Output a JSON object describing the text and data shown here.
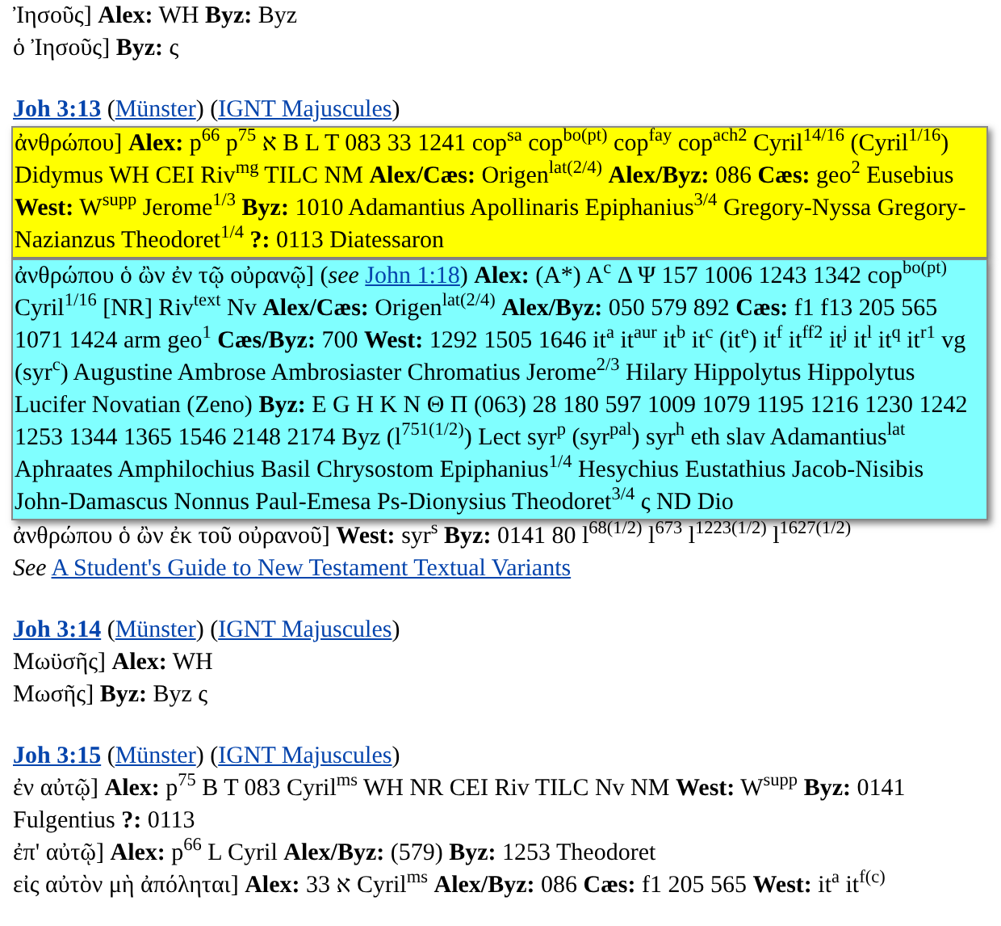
{
  "sections": [
    {
      "readings": [
        {
          "parts": [
            {
              "kind": "text",
              "text": "Ἰησοῦς] **Alex:** WH **Byz:** Byz"
            }
          ]
        },
        {
          "parts": [
            {
              "kind": "text",
              "text": "ὁ Ἰησοῦς] **Byz:** ς"
            }
          ]
        }
      ]
    },
    {
      "heading": {
        "verse": "Joh 3:13",
        "links": [
          {
            "open": "(",
            "text": "Münster",
            "close": ")"
          },
          {
            "open": "(",
            "text": "IGNT Majuscules",
            "close": ")"
          }
        ]
      },
      "readings": [
        {
          "color": "#ffff00",
          "parts": [
            {
              "kind": "text",
              "text": "ἀνθρώπου] **Alex:** p$^{66}$ p$^{75}$ א B L T 083 33 1241 cop$^{sa}$ cop$^{bo(pt)}$ cop$^{fay}$ cop$^{ach2}$ Cyril$^{14/16}$ (Cyril$^{1/16}$) Didymus WH CEI Riv$^{mg}$ TILC NM **Alex/Cæs:** Origen$^{lat(2/4)}$ **Alex/Byz:** 086 **Cæs:** geo$^{2}$ Eusebius **West:** W$^{supp}$ Jerome$^{1/3}$ **Byz:** 1010 Adamantius Apollinaris Epiphanius$^{3/4}$ Gregory-Nyssa Gregory-Nazianzus Theodoret$^{1/4}$ **?:** 0113 Diatessaron"
            }
          ]
        },
        {
          "color": "#80ffff",
          "parts": [
            {
              "kind": "text",
              "text": "ἀνθρώπου ὁ ὢν ἐν τῷ οὐρανῷ] (*see* "
            },
            {
              "kind": "link",
              "text": "John 1:18"
            },
            {
              "kind": "text",
              "text": ") **Alex:** (A*) A$^{c}$ Δ Ψ 157 1006 1243 1342 cop$^{bo(pt)}$ Cyril$^{1/16}$ [NR] Riv$^{text}$ Nv **Alex/Cæs:** Origen$^{lat(2/4)}$ **Alex/Byz:** 050 579 892 **Cæs:** f1 f13 205 565 1071 1424 arm geo$^{1}$ **Cæs/Byz:** 700 **West:** 1292 1505 1646 it$^{a}$ it$^{aur}$ it$^{b}$ it$^{c}$ (it$^{e}$) it$^{f}$ it$^{ff2}$ it$^{j}$ it$^{l}$ it$^{q}$ it$^{r1}$ vg (syr$^{c}$) Augustine Ambrose Ambrosiaster Chromatius Jerome$^{2/3}$ Hilary Hippolytus Hippolytus Lucifer Novatian (Zeno) **Byz:** E G H K N Θ Π (063) 28 180 597 1009 1079 1195 1216 1230 1242 1253 1344 1365 1546 2148 2174 Byz (l$^{751(1/2)}$) Lect syr$^{p}$ (syr$^{pal}$) syr$^{h}$ eth slav Adamantius$^{lat}$ Aphraates Amphilochius Basil Chrysostom Epiphanius$^{1/4}$ Hesychius Eustathius Jacob-Nisibis John-Damascus Nonnus Paul-Emesa Ps-Dionysius Theodoret$^{3/4}$ ς ND Dio"
            }
          ]
        },
        {
          "parts": [
            {
              "kind": "text",
              "text": "ἀνθρώπου ὁ ὢν ἐκ τοῦ οὐρανοῦ] **West:** syr$^{s}$ **Byz:** 0141 80 l$^{68(1/2)}$ l$^{673}$ l$^{1223(1/2)}$ l$^{1627(1/2)}$"
            }
          ]
        },
        {
          "parts": [
            {
              "kind": "text",
              "text": "*See* "
            },
            {
              "kind": "link",
              "text": "A Student's Guide to New Testament Textual Variants"
            }
          ]
        }
      ]
    },
    {
      "heading": {
        "verse": "Joh 3:14",
        "links": [
          {
            "open": "(",
            "text": "Münster",
            "close": ")"
          },
          {
            "open": "(",
            "text": "IGNT Majuscules",
            "close": ")"
          }
        ]
      },
      "readings": [
        {
          "parts": [
            {
              "kind": "text",
              "text": "Μωϋσῆς] **Alex:** WH"
            }
          ]
        },
        {
          "parts": [
            {
              "kind": "text",
              "text": "Μωσῆς] **Byz:** Byz ς"
            }
          ]
        }
      ]
    },
    {
      "heading": {
        "verse": "Joh 3:15",
        "links": [
          {
            "open": "(",
            "text": "Münster",
            "close": ")"
          },
          {
            "open": "(",
            "text": "IGNT Majuscules",
            "close": ")"
          }
        ]
      },
      "readings": [
        {
          "parts": [
            {
              "kind": "text",
              "text": "ἐν αὐτῷ] **Alex:** p$^{75}$ B T 083 Cyril$^{ms}$ WH NR CEI Riv TILC Nv NM **West:** W$^{supp}$ **Byz:** 0141 Fulgentius **?:** 0113"
            }
          ]
        },
        {
          "parts": [
            {
              "kind": "text",
              "text": "ἐπ' αὐτῷ] **Alex:** p$^{66}$ L Cyril **Alex/Byz:** (579) **Byz:** 1253 Theodoret"
            }
          ]
        },
        {
          "parts": [
            {
              "kind": "text",
              "text": "εἰς αὐτὸν μὴ ἀπόληται] **Alex:** א 33 Cyril$^{ms}$ **Alex/Byz:** 086 **Cæs:** f1 205 565 **West:** it$^{a}$ it$^{f(c)}$"
            }
          ]
        }
      ]
    }
  ]
}
